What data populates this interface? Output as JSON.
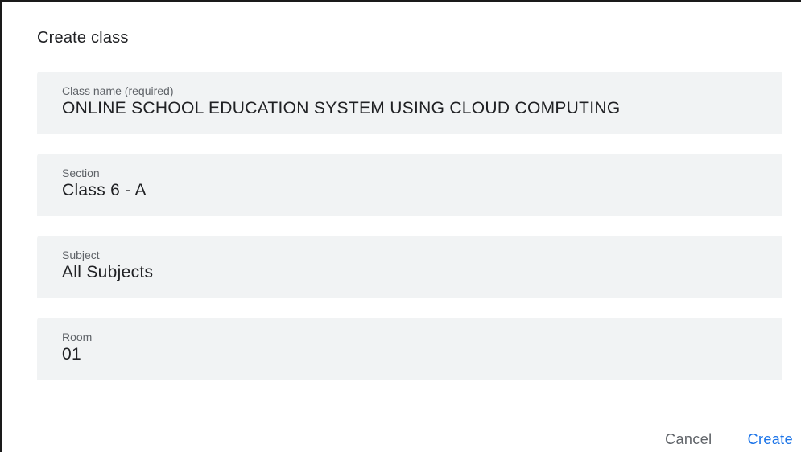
{
  "dialog": {
    "title": "Create class",
    "fields": [
      {
        "label": "Class name (required)",
        "value": "ONLINE SCHOOL EDUCATION SYSTEM USING CLOUD COMPUTING"
      },
      {
        "label": "Section",
        "value": "Class 6 - A"
      },
      {
        "label": "Subject",
        "value": "All Subjects"
      },
      {
        "label": "Room",
        "value": "01"
      }
    ],
    "actions": {
      "cancel_label": "Cancel",
      "create_label": "Create"
    }
  },
  "colors": {
    "accent": "#1a73e8",
    "field_background": "#f1f3f4",
    "label_text": "#5f6368",
    "value_text": "#202124"
  }
}
